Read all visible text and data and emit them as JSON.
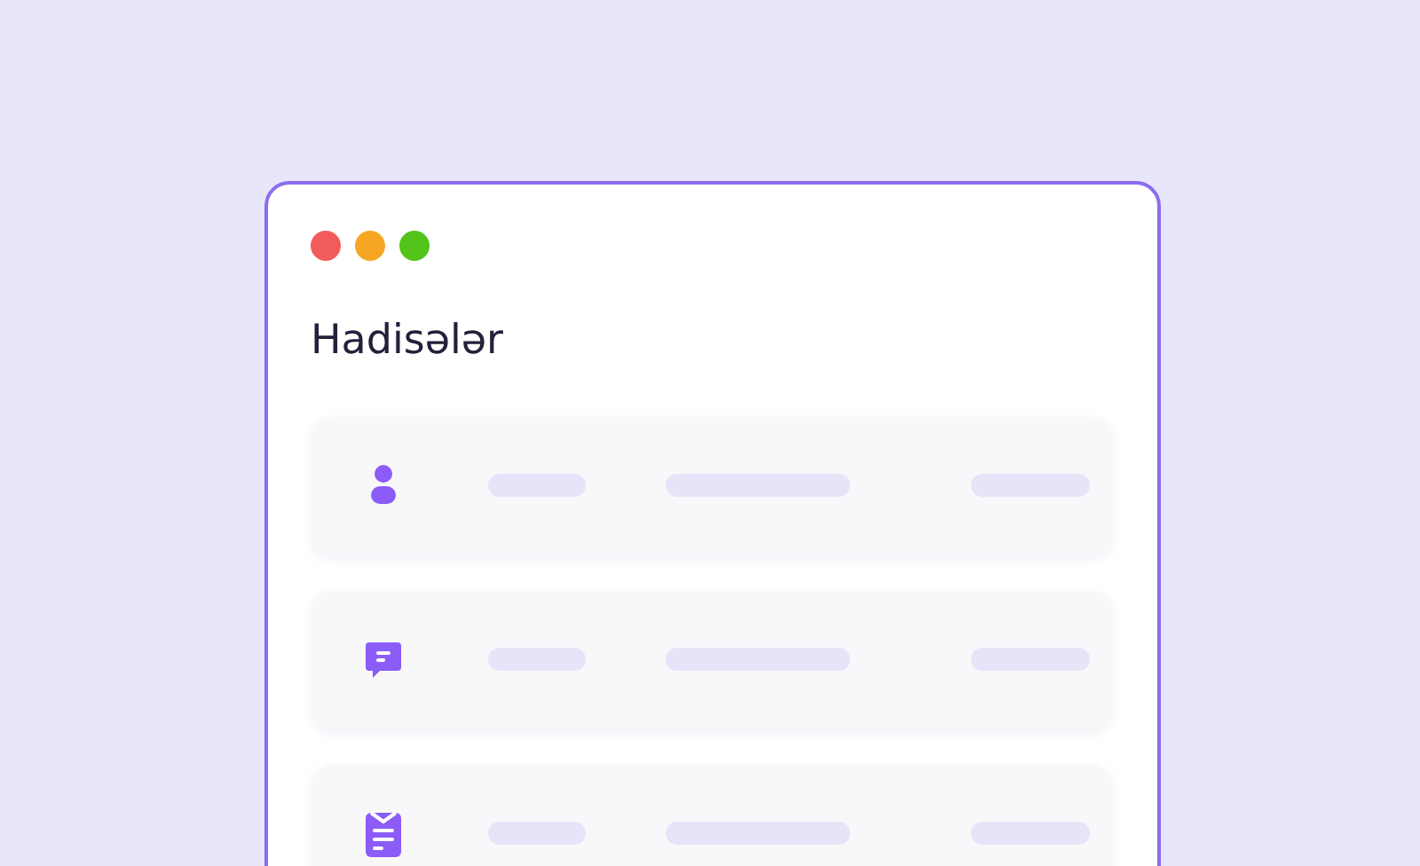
{
  "window": {
    "title": "Hadisələr",
    "controls": [
      {
        "color": "#f25b5b"
      },
      {
        "color": "#f5a623"
      },
      {
        "color": "#52c41a"
      }
    ]
  },
  "rows": [
    {
      "kind": "person"
    },
    {
      "kind": "chat"
    },
    {
      "kind": "clipboard"
    }
  ]
}
